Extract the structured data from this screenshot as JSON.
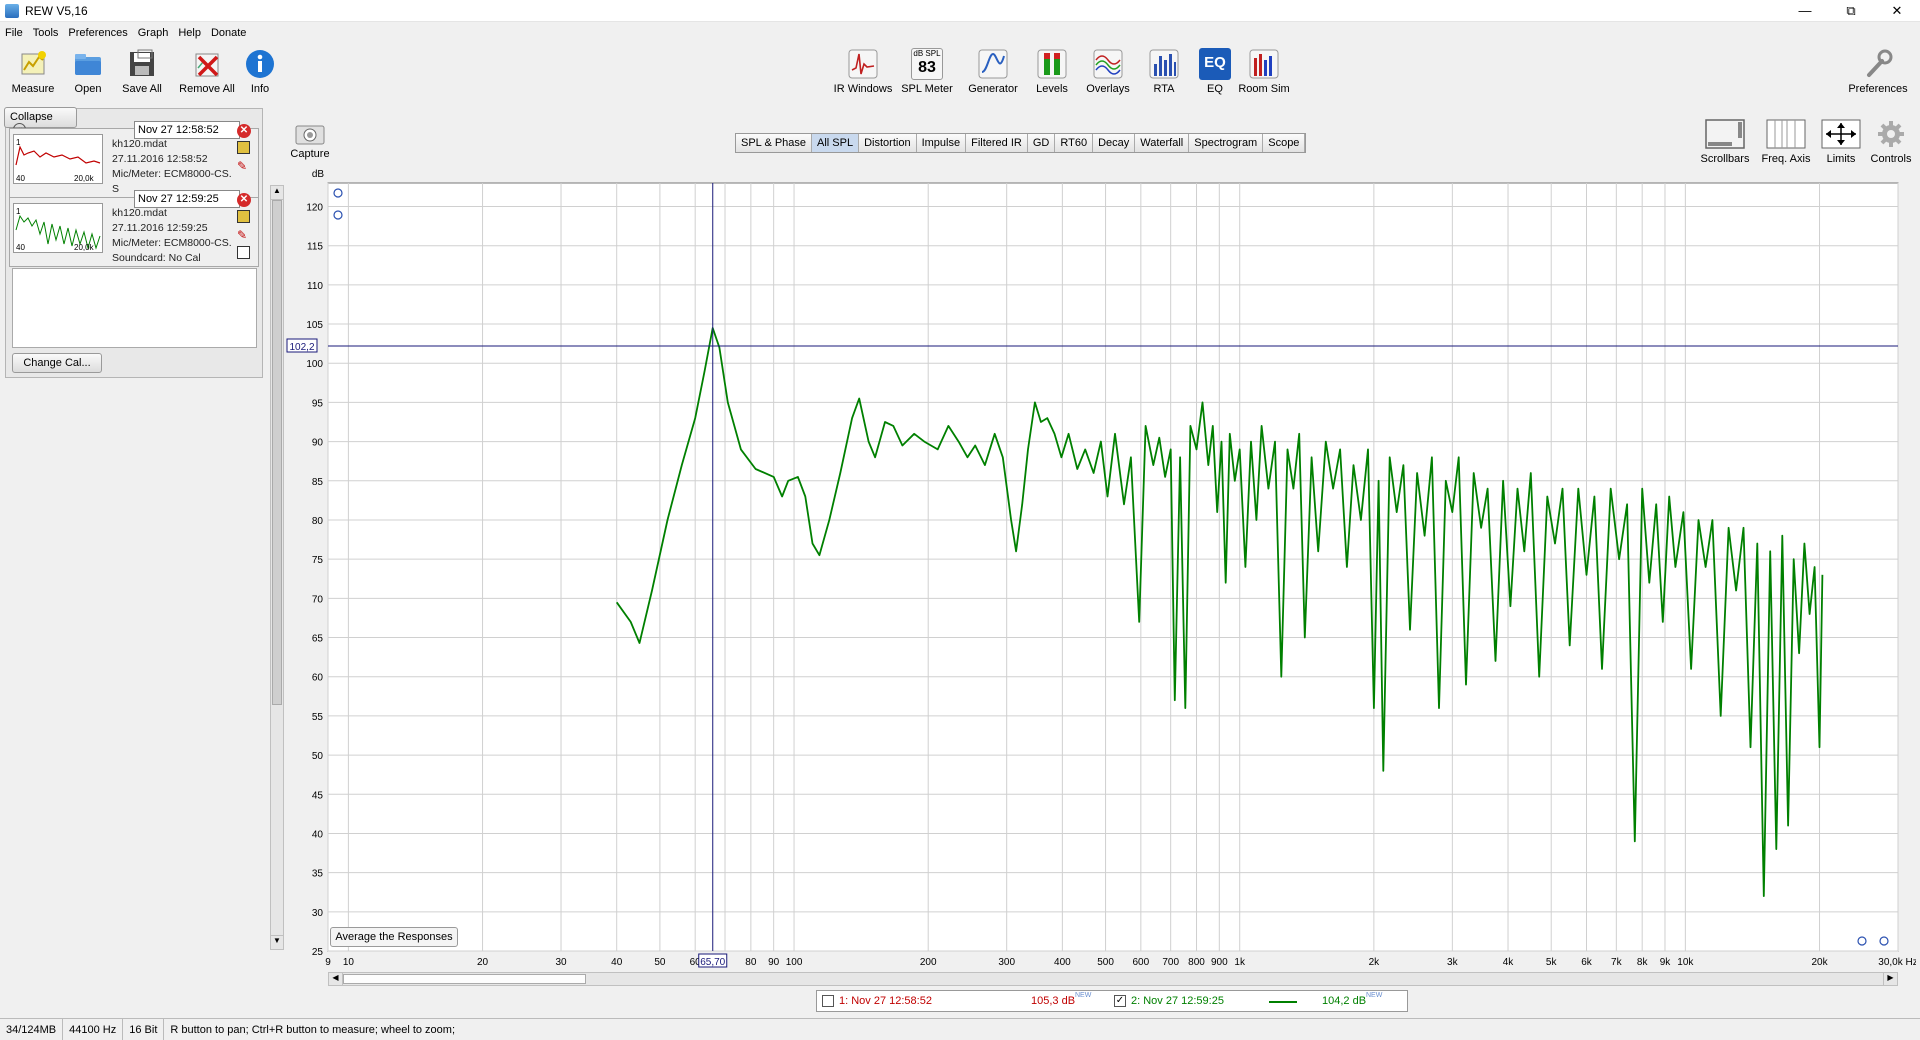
{
  "window": {
    "title": "REW V5,16"
  },
  "menu": [
    "File",
    "Tools",
    "Preferences",
    "Graph",
    "Help",
    "Donate"
  ],
  "toolbar_left": [
    {
      "label": "Measure",
      "icon": "measure-icon"
    },
    {
      "label": "Open",
      "icon": "folder-open-icon"
    },
    {
      "label": "Save All",
      "icon": "save-icon"
    },
    {
      "label": "Remove All",
      "icon": "remove-icon"
    },
    {
      "label": "Info",
      "icon": "info-icon"
    }
  ],
  "toolbar_center": [
    {
      "label": "IR Windows",
      "icon": "ir-windows-icon"
    },
    {
      "label": "SPL Meter",
      "icon": "spl-meter-icon",
      "readout_top": "dB SPL",
      "readout_value": "83"
    },
    {
      "label": "Generator",
      "icon": "generator-icon"
    },
    {
      "label": "Levels",
      "icon": "levels-icon"
    },
    {
      "label": "Overlays",
      "icon": "overlays-icon"
    },
    {
      "label": "RTA",
      "icon": "rta-icon"
    },
    {
      "label": "EQ",
      "icon": "eq-icon"
    },
    {
      "label": "Room Sim",
      "icon": "room-sim-icon"
    }
  ],
  "toolbar_right": {
    "preferences": "Preferences"
  },
  "capture": "Capture",
  "graph_controls": [
    {
      "label": "Scrollbars",
      "icon": "scrollbars-icon"
    },
    {
      "label": "Freq. Axis",
      "icon": "freq-axis-icon"
    },
    {
      "label": "Limits",
      "icon": "limits-icon"
    },
    {
      "label": "Controls",
      "icon": "gear-icon"
    }
  ],
  "panel": {
    "collapse": "Collapse",
    "measurements": [
      {
        "date": "Nov 27 12:58:52",
        "file": "kh120.mdat",
        "time": "27.11.2016 12:58:52",
        "mic": "Mic/Meter: ECM8000-CS.",
        "sound": "S",
        "thumb_color": "#c00000",
        "thumb_y_top": "1",
        "thumb_y_bot": "40",
        "thumb_x_end": "20,0k"
      },
      {
        "date": "Nov 27 12:59:25",
        "file": "kh120.mdat",
        "time": "27.11.2016 12:59:25",
        "mic": "Mic/Meter: ECM8000-CS.",
        "sound": "Soundcard: No Cal",
        "thumb_color": "#008000",
        "thumb_y_top": "1",
        "thumb_y_bot": "40",
        "thumb_x_end": "20,0k"
      }
    ],
    "change_cal": "Change Cal..."
  },
  "tabs": [
    "SPL & Phase",
    "All SPL",
    "Distortion",
    "Impulse",
    "Filtered IR",
    "GD",
    "RT60",
    "Decay",
    "Waterfall",
    "Spectrogram",
    "Scope"
  ],
  "active_tab": "All SPL",
  "average_btn": "Average the Responses",
  "cursor": {
    "db_readout": "102,2",
    "freq_readout": "65,70",
    "db_value": 102.2,
    "freq_value": 65.7
  },
  "legend": {
    "m1_label": "1: Nov 27 12:58:52",
    "m1_value": "105,3 dB",
    "m1_new": "NEW",
    "m1_checked": false,
    "m1_color": "#c00000",
    "m2_label": "2: Nov 27 12:59:25",
    "m2_value": "104,2 dB",
    "m2_new": "NEW",
    "m2_checked": true,
    "m2_color": "#008000"
  },
  "status": [
    "34/124MB",
    "44100 Hz",
    "16 Bit",
    "R button to pan; Ctrl+R button to measure; wheel to zoom;"
  ],
  "chart_data": {
    "type": "line",
    "xscale": "log",
    "xlim": [
      9,
      30000
    ],
    "ylim": [
      25,
      123
    ],
    "ylabel": "dB",
    "yticks": [
      25,
      30,
      35,
      40,
      45,
      50,
      55,
      60,
      65,
      70,
      75,
      80,
      85,
      90,
      95,
      100,
      105,
      110,
      115,
      120
    ],
    "xticks": [
      {
        "v": 9,
        "t": "9"
      },
      {
        "v": 10,
        "t": "10"
      },
      {
        "v": 20,
        "t": "20"
      },
      {
        "v": 30,
        "t": "30"
      },
      {
        "v": 40,
        "t": "40"
      },
      {
        "v": 50,
        "t": "50"
      },
      {
        "v": 60,
        "t": "60"
      },
      {
        "v": 80,
        "t": "80"
      },
      {
        "v": 90,
        "t": "90"
      },
      {
        "v": 100,
        "t": "100"
      },
      {
        "v": 200,
        "t": "200"
      },
      {
        "v": 300,
        "t": "300"
      },
      {
        "v": 400,
        "t": "400"
      },
      {
        "v": 500,
        "t": "500"
      },
      {
        "v": 600,
        "t": "600"
      },
      {
        "v": 700,
        "t": "700"
      },
      {
        "v": 800,
        "t": "800"
      },
      {
        "v": 900,
        "t": "900"
      },
      {
        "v": 1000,
        "t": "1k"
      },
      {
        "v": 2000,
        "t": "2k"
      },
      {
        "v": 3000,
        "t": "3k"
      },
      {
        "v": 4000,
        "t": "4k"
      },
      {
        "v": 5000,
        "t": "5k"
      },
      {
        "v": 6000,
        "t": "6k"
      },
      {
        "v": 7000,
        "t": "7k"
      },
      {
        "v": 8000,
        "t": "8k"
      },
      {
        "v": 9000,
        "t": "9k"
      },
      {
        "v": 10000,
        "t": "10k"
      },
      {
        "v": 20000,
        "t": "20k"
      },
      {
        "v": 30000,
        "t": "30,0k Hz"
      }
    ],
    "series": [
      {
        "color": "#008000",
        "points": [
          [
            40,
            69.5
          ],
          [
            43,
            67
          ],
          [
            45,
            64.3
          ],
          [
            48,
            71
          ],
          [
            52,
            80
          ],
          [
            56,
            87
          ],
          [
            60,
            93
          ],
          [
            63,
            99
          ],
          [
            65.7,
            104.5
          ],
          [
            68,
            102
          ],
          [
            71,
            95
          ],
          [
            76,
            89
          ],
          [
            82,
            86.5
          ],
          [
            90,
            85.5
          ],
          [
            94,
            83
          ],
          [
            97,
            85
          ],
          [
            102,
            85.5
          ],
          [
            106,
            83
          ],
          [
            110,
            77
          ],
          [
            114,
            75.5
          ],
          [
            120,
            80
          ],
          [
            127,
            86
          ],
          [
            135,
            93
          ],
          [
            140,
            95.5
          ],
          [
            147,
            90
          ],
          [
            152,
            88
          ],
          [
            160,
            92.5
          ],
          [
            167,
            92
          ],
          [
            175,
            89.5
          ],
          [
            186,
            91
          ],
          [
            196,
            90
          ],
          [
            210,
            89
          ],
          [
            222,
            92
          ],
          [
            234,
            90
          ],
          [
            245,
            88
          ],
          [
            255,
            89.5
          ],
          [
            268,
            87
          ],
          [
            282,
            91
          ],
          [
            294,
            88
          ],
          [
            307,
            80
          ],
          [
            315,
            76
          ],
          [
            325,
            82
          ],
          [
            335,
            89
          ],
          [
            347,
            95
          ],
          [
            358,
            92.5
          ],
          [
            370,
            93
          ],
          [
            384,
            91
          ],
          [
            398,
            88
          ],
          [
            413,
            91
          ],
          [
            432,
            86.5
          ],
          [
            450,
            89
          ],
          [
            470,
            86
          ],
          [
            488,
            90
          ],
          [
            505,
            83
          ],
          [
            525,
            91
          ],
          [
            550,
            82
          ],
          [
            570,
            88
          ],
          [
            595,
            67
          ],
          [
            615,
            92
          ],
          [
            640,
            87
          ],
          [
            660,
            90.5
          ],
          [
            680,
            85.5
          ],
          [
            700,
            89
          ],
          [
            715,
            57
          ],
          [
            735,
            88
          ],
          [
            755,
            56
          ],
          [
            775,
            92
          ],
          [
            800,
            89
          ],
          [
            825,
            95
          ],
          [
            850,
            87
          ],
          [
            870,
            92
          ],
          [
            890,
            81
          ],
          [
            910,
            90
          ],
          [
            930,
            72
          ],
          [
            950,
            91
          ],
          [
            975,
            85
          ],
          [
            1000,
            89
          ],
          [
            1030,
            74
          ],
          [
            1060,
            90
          ],
          [
            1090,
            80
          ],
          [
            1120,
            92
          ],
          [
            1160,
            84
          ],
          [
            1200,
            90
          ],
          [
            1240,
            60
          ],
          [
            1280,
            89
          ],
          [
            1320,
            84
          ],
          [
            1360,
            91
          ],
          [
            1400,
            65
          ],
          [
            1450,
            88
          ],
          [
            1500,
            76
          ],
          [
            1560,
            90
          ],
          [
            1620,
            84
          ],
          [
            1680,
            89
          ],
          [
            1740,
            74
          ],
          [
            1800,
            87
          ],
          [
            1870,
            80
          ],
          [
            1940,
            89
          ],
          [
            2000,
            56
          ],
          [
            2050,
            85
          ],
          [
            2100,
            48
          ],
          [
            2170,
            88
          ],
          [
            2250,
            81
          ],
          [
            2330,
            87
          ],
          [
            2410,
            66
          ],
          [
            2500,
            86
          ],
          [
            2600,
            78
          ],
          [
            2700,
            88
          ],
          [
            2800,
            56
          ],
          [
            2900,
            85
          ],
          [
            3000,
            81
          ],
          [
            3100,
            88
          ],
          [
            3220,
            59
          ],
          [
            3350,
            86
          ],
          [
            3480,
            79
          ],
          [
            3600,
            84
          ],
          [
            3750,
            62
          ],
          [
            3900,
            85
          ],
          [
            4050,
            69
          ],
          [
            4200,
            84
          ],
          [
            4350,
            76
          ],
          [
            4500,
            86
          ],
          [
            4700,
            60
          ],
          [
            4900,
            83
          ],
          [
            5100,
            77
          ],
          [
            5300,
            84
          ],
          [
            5500,
            64
          ],
          [
            5750,
            84
          ],
          [
            6000,
            73
          ],
          [
            6250,
            83
          ],
          [
            6500,
            61
          ],
          [
            6800,
            84
          ],
          [
            7100,
            75
          ],
          [
            7400,
            82
          ],
          [
            7700,
            39
          ],
          [
            8000,
            84
          ],
          [
            8300,
            72
          ],
          [
            8600,
            82
          ],
          [
            8900,
            67
          ],
          [
            9200,
            83
          ],
          [
            9500,
            74
          ],
          [
            9900,
            81
          ],
          [
            10300,
            61
          ],
          [
            10700,
            80
          ],
          [
            11100,
            74
          ],
          [
            11500,
            80
          ],
          [
            12000,
            55
          ],
          [
            12500,
            79
          ],
          [
            13000,
            71
          ],
          [
            13500,
            79
          ],
          [
            14000,
            51
          ],
          [
            14500,
            77
          ],
          [
            15000,
            32
          ],
          [
            15500,
            76
          ],
          [
            16000,
            38
          ],
          [
            16500,
            78
          ],
          [
            17000,
            41
          ],
          [
            17500,
            75
          ],
          [
            18000,
            63
          ],
          [
            18500,
            77
          ],
          [
            19000,
            68
          ],
          [
            19500,
            74
          ],
          [
            20000,
            51
          ],
          [
            20300,
            73
          ]
        ]
      }
    ]
  }
}
